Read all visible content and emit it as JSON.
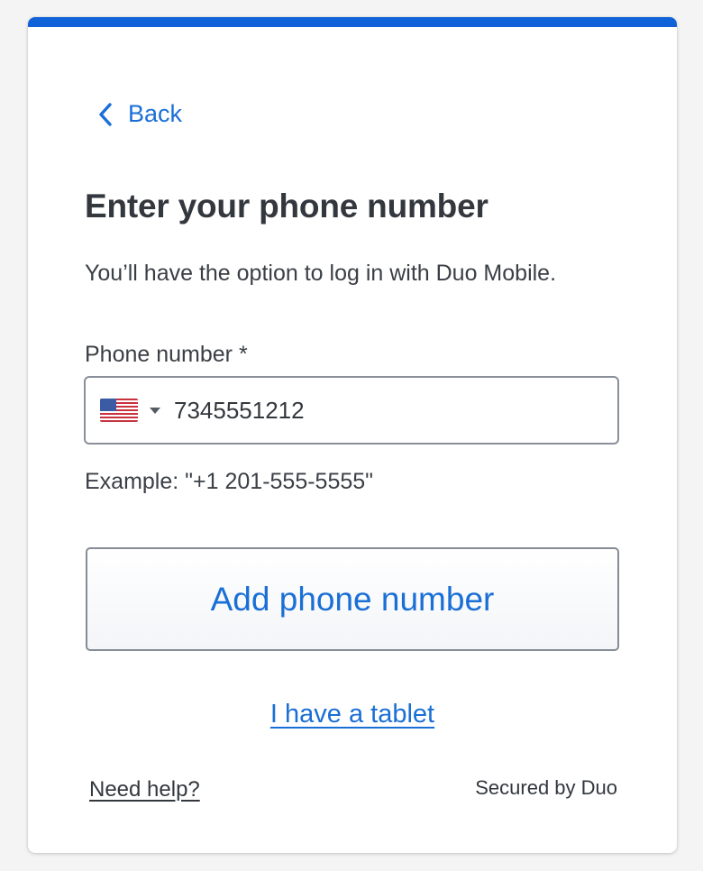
{
  "colors": {
    "accent": "#0f62d8",
    "link": "#1a6fd6",
    "text": "#33383e",
    "background": "#f4f4f5"
  },
  "nav": {
    "back_label": "Back",
    "back_icon": "chevron-left-icon"
  },
  "page": {
    "title": "Enter your phone number",
    "description": "You’ll have the option to log in with Duo Mobile."
  },
  "phone_field": {
    "label": "Phone number *",
    "country_flag": "us-flag-icon",
    "country_caret": "caret-down-icon",
    "value": "7345551212",
    "example": "Example: \"+1 201-555-5555\""
  },
  "actions": {
    "add_phone_label": "Add phone number",
    "tablet_link_label": "I have a tablet"
  },
  "footer": {
    "help_label": "Need help?",
    "secured_label": "Secured by Duo"
  }
}
